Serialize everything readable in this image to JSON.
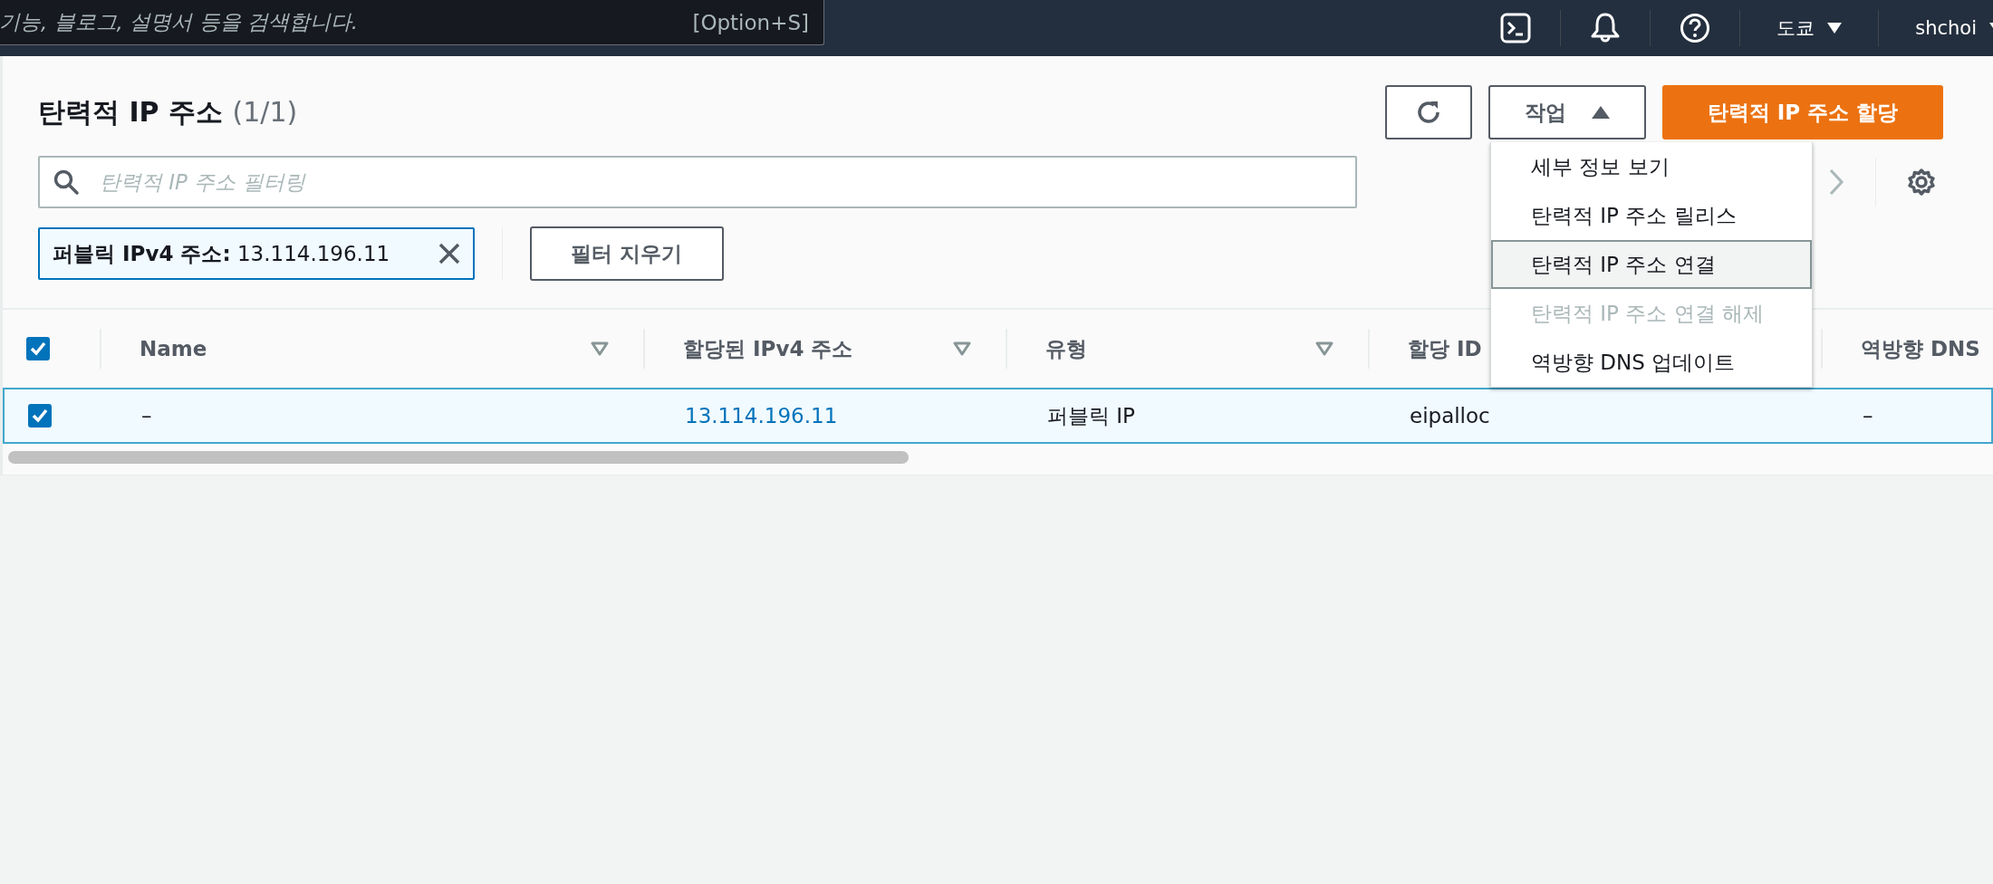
{
  "top_bar": {
    "search": {
      "placeholder": "기능, 블로그, 설명서 등을 검색합니다.",
      "shortcut": "[Option+S]"
    },
    "region": "도쿄",
    "user": "shchoi"
  },
  "panel": {
    "title": "탄력적 IP 주소",
    "count": "(1/1)",
    "actions_button": {
      "label": "작업",
      "expanded": true
    },
    "primary_button": "탄력적 IP 주소 할당",
    "filter": {
      "placeholder": "탄력적 IP 주소 필터링"
    },
    "filter_tokens": [
      {
        "key": "퍼블릭 IPv4 주소:",
        "value": "13.114.196.11"
      }
    ],
    "clear_filters": "필터 지우기"
  },
  "menu": [
    {
      "label": "세부 정보 보기",
      "selected": false,
      "disabled": false
    },
    {
      "label": "탄력적 IP 주소 릴리스",
      "selected": false,
      "disabled": false
    },
    {
      "label": "탄력적 IP 주소 연결",
      "selected": true,
      "disabled": false
    },
    {
      "label": "탄력적 IP 주소 연결 해제",
      "selected": false,
      "disabled": true
    },
    {
      "label": "역방향 DNS 업데이트",
      "selected": false,
      "disabled": false
    }
  ],
  "table": {
    "all_selected": true,
    "columns": [
      {
        "label": "Name",
        "kind": "text",
        "sortable": true
      },
      {
        "label": "할당된 IPv4 주소",
        "kind": "link",
        "sortable": true
      },
      {
        "label": "유형",
        "kind": "text",
        "sortable": true
      },
      {
        "label": "할당 ID",
        "kind": "text"
      },
      {
        "label": "역방향 DNS",
        "kind": "text"
      }
    ],
    "rows": [
      {
        "selected": true,
        "cells": [
          "–",
          "13.114.196.11",
          "퍼블릭 IP",
          "eipalloc",
          "–"
        ]
      }
    ]
  }
}
